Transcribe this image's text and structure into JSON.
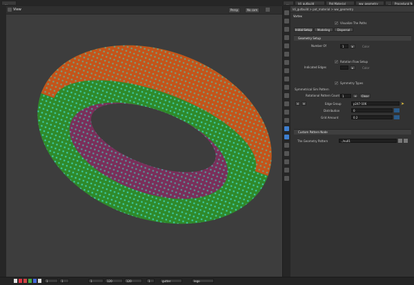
{
  "top_tabs": [
    "...",
    "...",
    "ldi_gutbuild",
    "Pat Material",
    "ww_geometry",
    "...",
    "Procedural Nodes"
  ],
  "viewport": {
    "label": "View",
    "display_buttons": [
      "Persp",
      "No cam"
    ],
    "colors": {
      "outer": "#c4541a",
      "band": "#2f8a2a",
      "inner": "#7a2f5a",
      "points": "#3fd6c2",
      "bg": "#3d3d3d"
    }
  },
  "panel": {
    "node_path": "ldi_gutbuild  >  pat_material  >  ww_geometry",
    "title": "Vortex",
    "top_checkbox_label": "Visualize The Paths",
    "tabs": [
      "Initial Setup",
      "Modeling",
      "Dispersal"
    ],
    "geometry_setup": {
      "header": "Geometry Setup",
      "row1_label": "Number Of",
      "row1_value": "1",
      "row1_extra": "Color",
      "checkbox2_label": "Rotation Flow Setup",
      "row2_label": "Indicated Edges",
      "row2_extra": "Color"
    },
    "symmetry": {
      "checkbox_label": "Symmetry Types",
      "pattern_header": "Symmetrical Sim Pattern",
      "group_label": "Rotational Pattern Count",
      "group_value": "1",
      "group_btn": "Clear",
      "edge_label": "Edge Group",
      "edge_value": "p247-106",
      "dist_label": "Distribution",
      "dist_value": "0",
      "rot_label": "Grid Amount",
      "rot_value": "0.2"
    },
    "custom": {
      "header": "Custom Pattern Node",
      "path_label": "The Geometry Pattern",
      "path_value": "../null1"
    }
  },
  "statusbar": {
    "frame_start": "1",
    "frame_end": "1",
    "current": "1",
    "field_a": "120",
    "field_b": "120",
    "field_c": "1",
    "items": [
      "gutter",
      "lego"
    ]
  }
}
